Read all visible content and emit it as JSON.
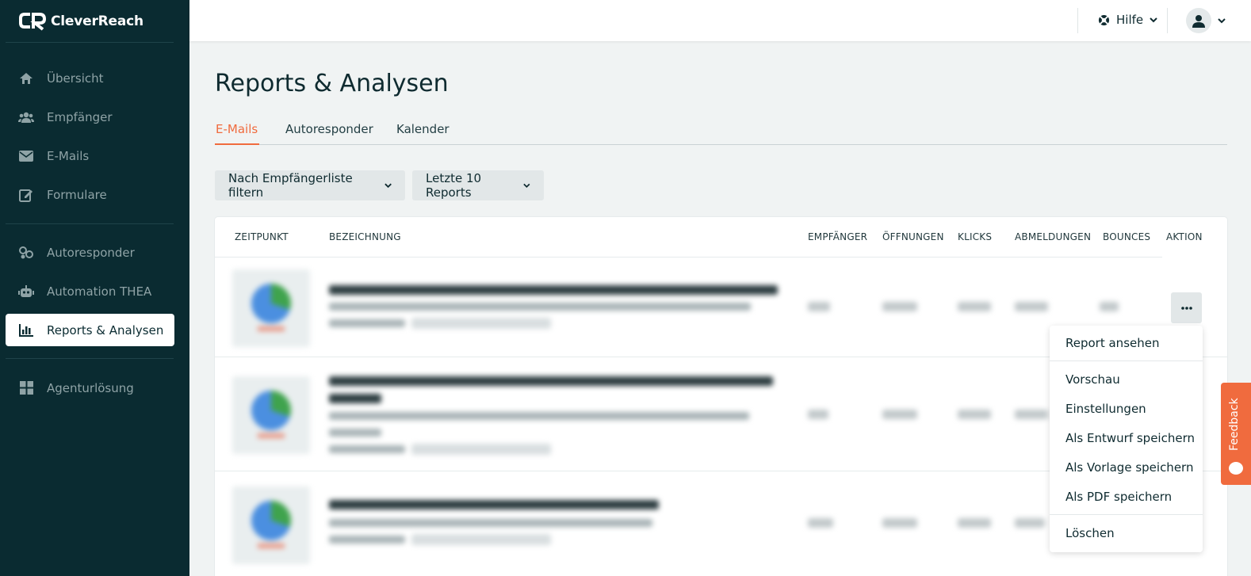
{
  "app": {
    "brand": "CleverReach"
  },
  "sidebar": {
    "items": [
      {
        "label": "Übersicht",
        "icon": "home-icon"
      },
      {
        "label": "Empfänger",
        "icon": "users-icon"
      },
      {
        "label": "E-Mails",
        "icon": "envelope-icon"
      },
      {
        "label": "Formulare",
        "icon": "form-edit-icon"
      },
      {
        "label": "Autoresponder",
        "icon": "autoresponder-icon"
      },
      {
        "label": "Automation THEA",
        "icon": "robot-icon"
      },
      {
        "label": "Reports & Analysen",
        "icon": "bar-chart-icon",
        "active": true
      },
      {
        "label": "Agenturlösung",
        "icon": "grid-icon"
      }
    ]
  },
  "topbar": {
    "help_label": "Hilfe"
  },
  "main": {
    "title": "Reports & Analysen",
    "tabs": [
      {
        "label": "E-Mails",
        "active": true
      },
      {
        "label": "Autoresponder"
      },
      {
        "label": "Kalender"
      }
    ],
    "filters": {
      "recipient_list": "Nach Empfängerliste filtern",
      "last_reports": "Letzte 10 Reports"
    },
    "table": {
      "columns": [
        "ZEITPUNKT",
        "BEZEICHNUNG",
        "EMPFÄNGER",
        "ÖFFNUNGEN",
        "KLICKS",
        "ABMELDUNGEN",
        "BOUNCES",
        "AKTION"
      ]
    }
  },
  "action_menu": {
    "items": [
      "Report ansehen",
      "Vorschau",
      "Einstellungen",
      "Als Entwurf speichern",
      "Als Vorlage speichern",
      "Als PDF speichern",
      "Löschen"
    ]
  },
  "feedback": {
    "label": "Feedback"
  },
  "colors": {
    "sidebar_bg": "#0a2b31",
    "accent": "#f06b3e",
    "page_bg": "#f0f3f3"
  }
}
